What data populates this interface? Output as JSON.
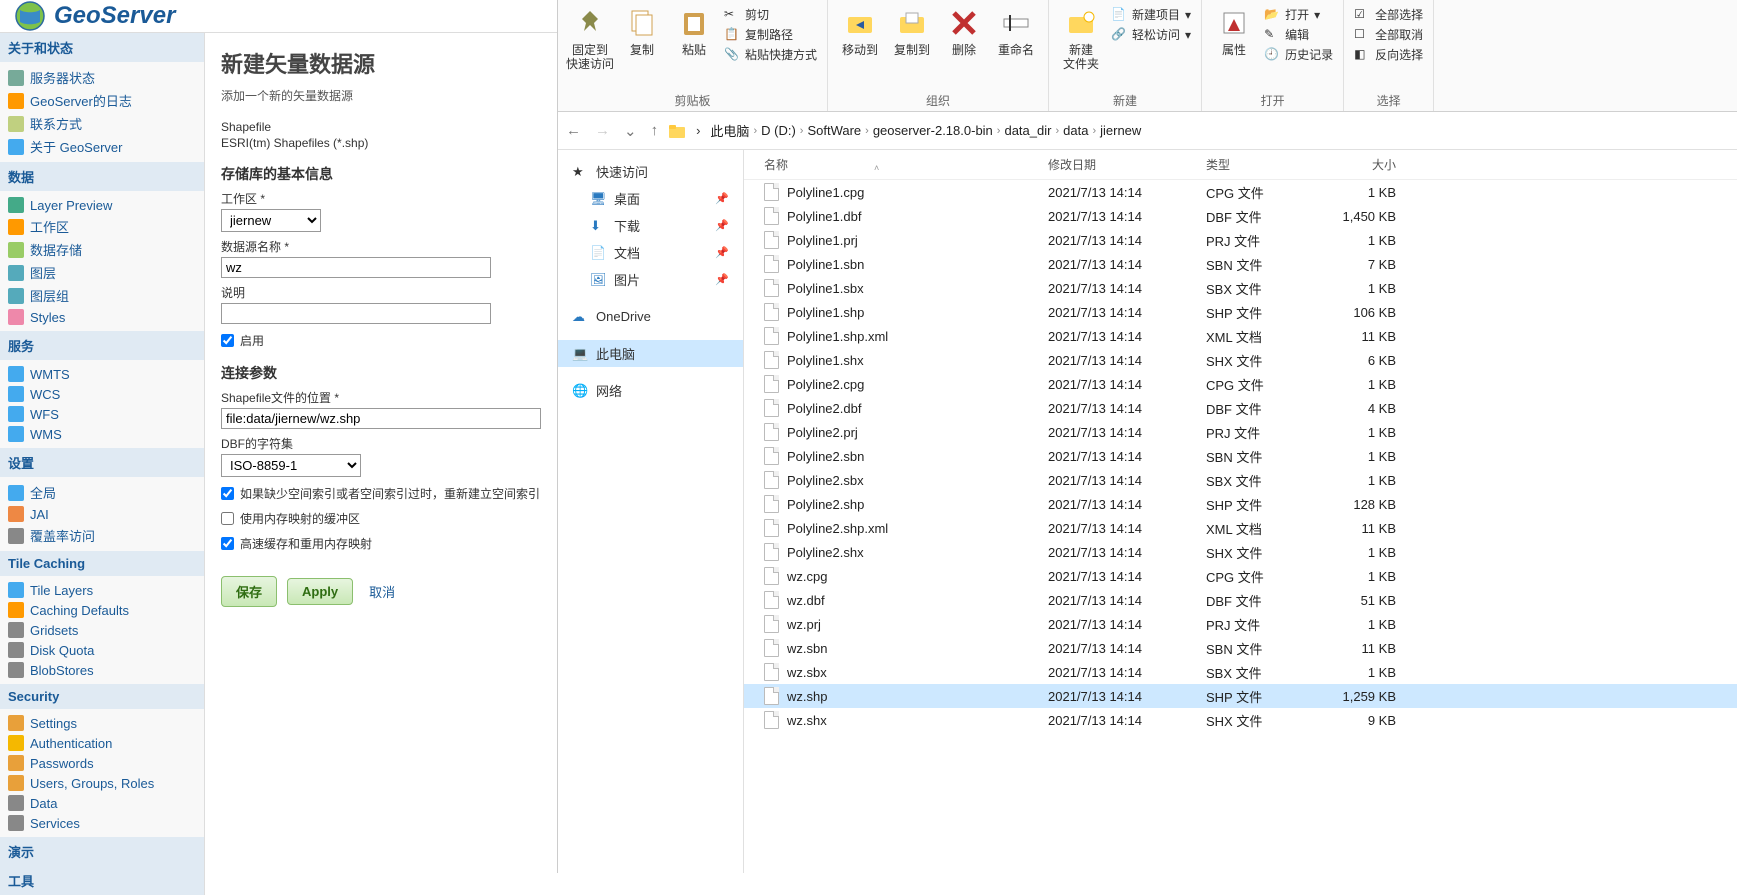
{
  "geoserver": {
    "brand": "GeoServer",
    "nav": {
      "about": {
        "title": "关于和状态",
        "items": [
          "服务器状态",
          "GeoServer的日志",
          "联系方式",
          "关于 GeoServer"
        ]
      },
      "data": {
        "title": "数据",
        "items": [
          "Layer Preview",
          "工作区",
          "数据存储",
          "图层",
          "图层组",
          "Styles"
        ]
      },
      "services": {
        "title": "服务",
        "items": [
          "WMTS",
          "WCS",
          "WFS",
          "WMS"
        ]
      },
      "settings": {
        "title": "设置",
        "items": [
          "全局",
          "JAI",
          "覆盖率访问"
        ]
      },
      "tile": {
        "title": "Tile Caching",
        "items": [
          "Tile Layers",
          "Caching Defaults",
          "Gridsets",
          "Disk Quota",
          "BlobStores"
        ]
      },
      "security": {
        "title": "Security",
        "items": [
          "Settings",
          "Authentication",
          "Passwords",
          "Users, Groups, Roles",
          "Data",
          "Services"
        ]
      },
      "demo": {
        "title": "演示"
      },
      "tools": {
        "title": "工具"
      }
    },
    "page": {
      "title": "新建矢量数据源",
      "subtitle": "添加一个新的矢量数据源",
      "driver_name": "Shapefile",
      "driver_desc": "ESRI(tm) Shapefiles (*.shp)",
      "section_store": "存储库的基本信息",
      "lbl_workspace": "工作区 *",
      "workspace_value": "jiernew",
      "lbl_name": "数据源名称 *",
      "name_value": "wz",
      "lbl_desc": "说明",
      "desc_value": "",
      "chk_enabled": "启用",
      "section_conn": "连接参数",
      "lbl_file": "Shapefile文件的位置 *",
      "file_value": "file:data/jiernew/wz.shp",
      "lbl_charset": "DBF的字符集",
      "charset_value": "ISO-8859-1",
      "chk_spatial": "如果缺少空间索引或者空间索引过时，重新建立空间索引",
      "chk_memory": "使用内存映射的缓冲区",
      "chk_cache": "高速缓存和重用内存映射",
      "btn_save": "保存",
      "btn_apply": "Apply",
      "btn_cancel": "取消"
    }
  },
  "explorer": {
    "ribbon": {
      "pin": {
        "l1": "固定到",
        "l2": "快速访问"
      },
      "copy": "复制",
      "paste": "粘贴",
      "cut": "剪切",
      "copy_path": "复制路径",
      "paste_shortcut": "粘贴快捷方式",
      "grp_clipboard": "剪贴板",
      "move_to": "移动到",
      "copy_to": "复制到",
      "delete": "删除",
      "rename": "重命名",
      "grp_organize": "组织",
      "new_folder": {
        "l1": "新建",
        "l2": "文件夹"
      },
      "new_item": "新建项目",
      "easy_access": "轻松访问",
      "grp_new": "新建",
      "properties": "属性",
      "open": "打开",
      "edit": "编辑",
      "history": "历史记录",
      "grp_open": "打开",
      "select_all": "全部选择",
      "select_none": "全部取消",
      "invert": "反向选择",
      "grp_select": "选择"
    },
    "breadcrumb": [
      "此电脑",
      "D (D:)",
      "SoftWare",
      "geoserver-2.18.0-bin",
      "data_dir",
      "data",
      "jiernew"
    ],
    "tree": {
      "quick": "快速访问",
      "desktop": "桌面",
      "downloads": "下载",
      "documents": "文档",
      "pictures": "图片",
      "onedrive": "OneDrive",
      "this_pc": "此电脑",
      "network": "网络"
    },
    "columns": {
      "name": "名称",
      "date": "修改日期",
      "type": "类型",
      "size": "大小"
    },
    "files": [
      {
        "name": "Polyline1.cpg",
        "date": "2021/7/13 14:14",
        "type": "CPG 文件",
        "size": "1 KB",
        "sel": false
      },
      {
        "name": "Polyline1.dbf",
        "date": "2021/7/13 14:14",
        "type": "DBF 文件",
        "size": "1,450 KB",
        "sel": false
      },
      {
        "name": "Polyline1.prj",
        "date": "2021/7/13 14:14",
        "type": "PRJ 文件",
        "size": "1 KB",
        "sel": false
      },
      {
        "name": "Polyline1.sbn",
        "date": "2021/7/13 14:14",
        "type": "SBN 文件",
        "size": "7 KB",
        "sel": false
      },
      {
        "name": "Polyline1.sbx",
        "date": "2021/7/13 14:14",
        "type": "SBX 文件",
        "size": "1 KB",
        "sel": false
      },
      {
        "name": "Polyline1.shp",
        "date": "2021/7/13 14:14",
        "type": "SHP 文件",
        "size": "106 KB",
        "sel": false
      },
      {
        "name": "Polyline1.shp.xml",
        "date": "2021/7/13 14:14",
        "type": "XML 文档",
        "size": "11 KB",
        "sel": false
      },
      {
        "name": "Polyline1.shx",
        "date": "2021/7/13 14:14",
        "type": "SHX 文件",
        "size": "6 KB",
        "sel": false
      },
      {
        "name": "Polyline2.cpg",
        "date": "2021/7/13 14:14",
        "type": "CPG 文件",
        "size": "1 KB",
        "sel": false
      },
      {
        "name": "Polyline2.dbf",
        "date": "2021/7/13 14:14",
        "type": "DBF 文件",
        "size": "4 KB",
        "sel": false
      },
      {
        "name": "Polyline2.prj",
        "date": "2021/7/13 14:14",
        "type": "PRJ 文件",
        "size": "1 KB",
        "sel": false
      },
      {
        "name": "Polyline2.sbn",
        "date": "2021/7/13 14:14",
        "type": "SBN 文件",
        "size": "1 KB",
        "sel": false
      },
      {
        "name": "Polyline2.sbx",
        "date": "2021/7/13 14:14",
        "type": "SBX 文件",
        "size": "1 KB",
        "sel": false
      },
      {
        "name": "Polyline2.shp",
        "date": "2021/7/13 14:14",
        "type": "SHP 文件",
        "size": "128 KB",
        "sel": false
      },
      {
        "name": "Polyline2.shp.xml",
        "date": "2021/7/13 14:14",
        "type": "XML 文档",
        "size": "11 KB",
        "sel": false
      },
      {
        "name": "Polyline2.shx",
        "date": "2021/7/13 14:14",
        "type": "SHX 文件",
        "size": "1 KB",
        "sel": false
      },
      {
        "name": "wz.cpg",
        "date": "2021/7/13 14:14",
        "type": "CPG 文件",
        "size": "1 KB",
        "sel": false
      },
      {
        "name": "wz.dbf",
        "date": "2021/7/13 14:14",
        "type": "DBF 文件",
        "size": "51 KB",
        "sel": false
      },
      {
        "name": "wz.prj",
        "date": "2021/7/13 14:14",
        "type": "PRJ 文件",
        "size": "1 KB",
        "sel": false
      },
      {
        "name": "wz.sbn",
        "date": "2021/7/13 14:14",
        "type": "SBN 文件",
        "size": "11 KB",
        "sel": false
      },
      {
        "name": "wz.sbx",
        "date": "2021/7/13 14:14",
        "type": "SBX 文件",
        "size": "1 KB",
        "sel": false
      },
      {
        "name": "wz.shp",
        "date": "2021/7/13 14:14",
        "type": "SHP 文件",
        "size": "1,259 KB",
        "sel": true
      },
      {
        "name": "wz.shx",
        "date": "2021/7/13 14:14",
        "type": "SHX 文件",
        "size": "9 KB",
        "sel": false
      }
    ]
  }
}
